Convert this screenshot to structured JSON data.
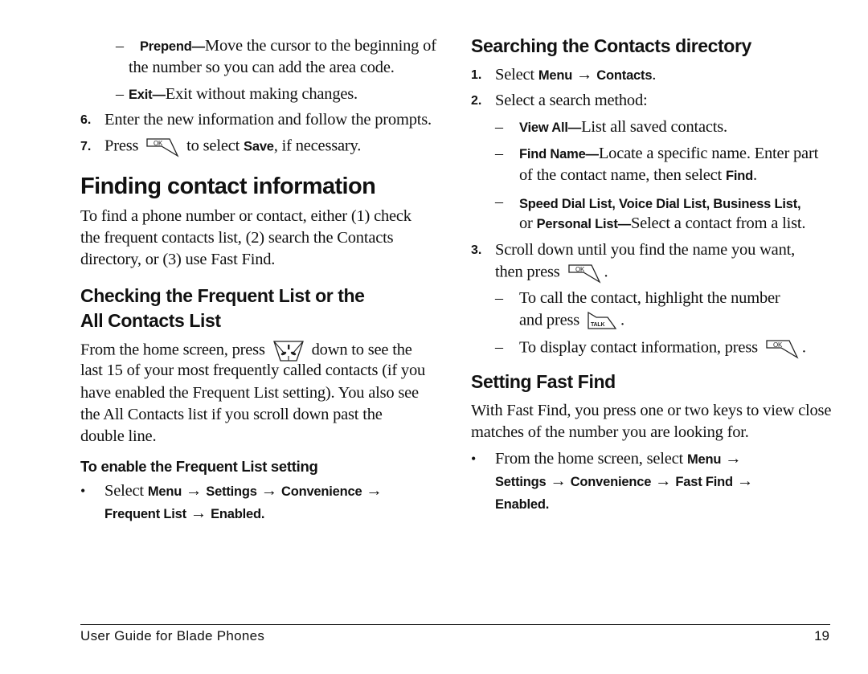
{
  "left_column": {
    "prepend_item": {
      "term": "Prepend—",
      "text_line1": "Move the cursor to the beginning of",
      "text_line2": "the number so you can add the area code."
    },
    "exit_item": {
      "term": "Exit—",
      "text": "Exit without making changes."
    },
    "step6": {
      "number": "6.",
      "text": "Enter the new information and follow the prompts."
    },
    "step7": {
      "number": "7.",
      "before": "Press",
      "after": "to select",
      "term": "Save",
      "end": ", if necessary.",
      "icon": "ok-key-icon"
    },
    "section_title": "Finding contact information",
    "intro_lines": [
      "To find a phone number or contact, either (1) check",
      "the frequent contacts list, (2) search the Contacts",
      "directory, or (3) use Fast Find."
    ],
    "subsection_title_line1": "Checking the Frequent List or the",
    "subsection_title_line2": "All Contacts List",
    "frequent_para": {
      "line1_before": "From the home screen, press",
      "line1_after": "down to see the",
      "icon": "navigation-key-icon",
      "lines": [
        "last 15 of your most frequently called contacts (if you",
        "have enabled the Frequent List setting). You also see",
        "the All Contacts list if you scroll down past the",
        "double line."
      ]
    },
    "procedure_title": "To enable the Frequent List setting",
    "procedure_bullet": {
      "select": "Select",
      "path_line1": [
        "Menu",
        "Settings",
        "Convenience"
      ],
      "path_line2": [
        "Frequent List",
        "Enabled"
      ],
      "arrow": "→",
      "end": "."
    }
  },
  "right_column": {
    "section_title": "Searching the Contacts directory",
    "step1": {
      "number": "1.",
      "select": "Select",
      "path": [
        "Menu",
        "Contacts"
      ],
      "arrow": "→",
      "end": "."
    },
    "step2": {
      "number": "2.",
      "text": "Select a search method:"
    },
    "methods": [
      {
        "term": "View All—",
        "text": "List all saved contacts."
      },
      {
        "term": "Find Name—",
        "text_line1": "Locate a specific name. Enter part",
        "text_line2_before": "of the contact name, then select",
        "text_line2_term": "Find",
        "text_line2_end": "."
      },
      {
        "term_line1": "Speed Dial List, Voice Dial List, Business List,",
        "line2_or": "or",
        "term_line2": "Personal List—",
        "text": "Select a contact from a list."
      }
    ],
    "step3": {
      "number": "3.",
      "line1": "Scroll down until you find the name you want,",
      "line2": "then press",
      "icon": "ok-key-icon",
      "end": "."
    },
    "sub_call": {
      "line1": "To call the contact, highlight the number",
      "line2": "and press",
      "icon": "talk-key-icon",
      "icon_label": "TALK",
      "end": "."
    },
    "sub_display": {
      "text": "To display contact information, press",
      "icon": "ok-key-icon",
      "end": "."
    },
    "fastfind_title": "Setting Fast Find",
    "fastfind_lines": [
      "With Fast Find, you press one or two keys to view close",
      "matches of the number you are looking for."
    ],
    "fastfind_bullet": {
      "text": "From the home screen, select",
      "path_line1": [
        "Menu"
      ],
      "path_line2": [
        "Settings",
        "Convenience",
        "Fast Find"
      ],
      "path_line3": [
        "Enabled"
      ],
      "arrow": "→",
      "end": "."
    }
  },
  "ok_label": "OK",
  "footer": {
    "title": "User Guide for Blade Phones",
    "page_number": "19"
  }
}
